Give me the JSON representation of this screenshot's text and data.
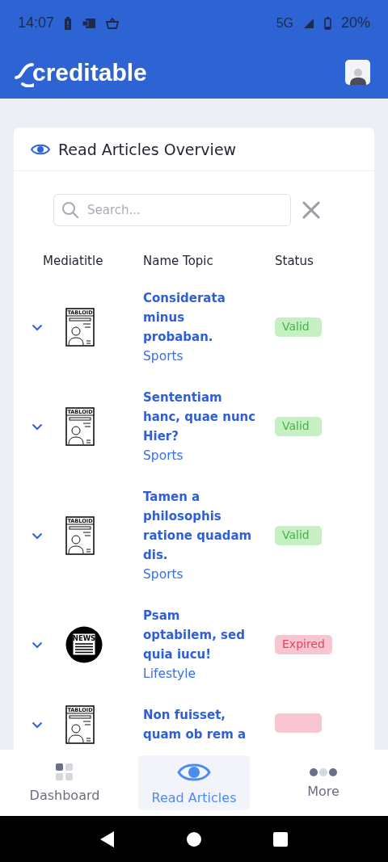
{
  "status_bar": {
    "time": "14:07",
    "network": "5G",
    "battery": "20%"
  },
  "app_bar": {
    "logo": "creditable"
  },
  "card": {
    "title": "Read Articles Overview",
    "search": {
      "placeholder": "Search..."
    },
    "columns": [
      "Mediatitle",
      "Name Topic",
      "Status"
    ],
    "rows": [
      {
        "media": {
          "kind": "tabloid",
          "label": "TABLOID"
        },
        "title": "Considerata minus probaban.",
        "topic": "Sports",
        "status": {
          "kind": "valid",
          "label": "Valid"
        }
      },
      {
        "media": {
          "kind": "tabloid",
          "label": "TABLOID"
        },
        "title": "Sententiam hanc, quae nunc Hier?",
        "topic": "Sports",
        "status": {
          "kind": "valid",
          "label": "Valid"
        }
      },
      {
        "media": {
          "kind": "tabloid",
          "label": "TABLOID"
        },
        "title": "Tamen a philosophis ratione quadam dis.",
        "topic": "Sports",
        "status": {
          "kind": "valid",
          "label": "Valid"
        }
      },
      {
        "media": {
          "kind": "news",
          "label": "NEWS"
        },
        "title": "Psam optabilem, sed quia iucu!",
        "topic": "Lifestyle",
        "status": {
          "kind": "expired",
          "label": "Expired"
        }
      },
      {
        "media": {
          "kind": "tabloid",
          "label": "TABLOID"
        },
        "title": "Non fuisset, quam ob rem a",
        "status": {
          "kind": "expired"
        }
      }
    ]
  },
  "bottom_nav": [
    {
      "label": "Dashboard",
      "kind": "grid",
      "selected": false
    },
    {
      "label": "Read Articles",
      "kind": "eye",
      "selected": true
    },
    {
      "label": "More",
      "kind": "dots",
      "selected": false
    }
  ]
}
